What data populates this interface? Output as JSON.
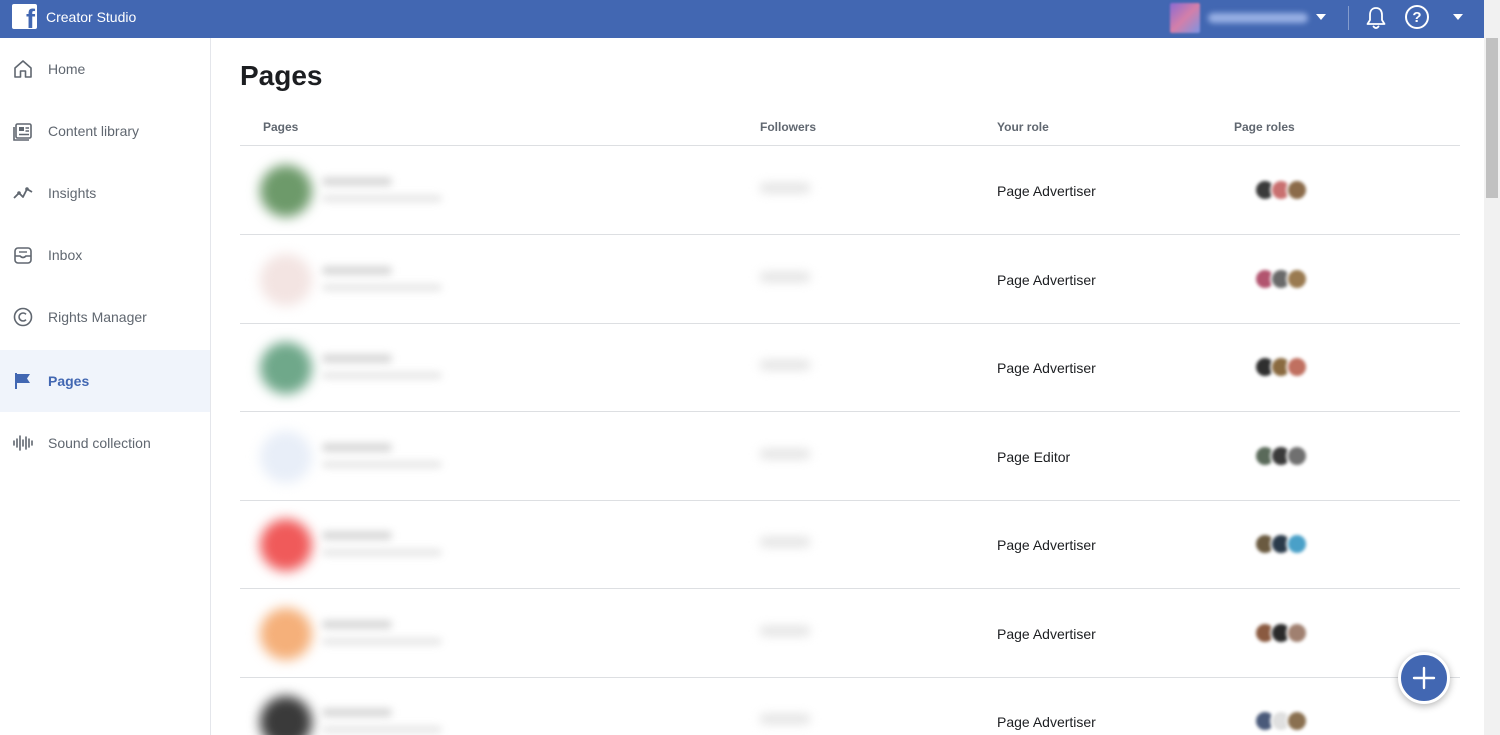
{
  "topbar": {
    "app_title": "Creator Studio",
    "brand_color": "#4267b2"
  },
  "sidebar": {
    "items": [
      {
        "label": "Home",
        "icon": "home-icon",
        "active": false
      },
      {
        "label": "Content library",
        "icon": "content-library-icon",
        "active": false
      },
      {
        "label": "Insights",
        "icon": "insights-icon",
        "active": false
      },
      {
        "label": "Inbox",
        "icon": "inbox-icon",
        "active": false
      },
      {
        "label": "Rights Manager",
        "icon": "copyright-icon",
        "active": false
      },
      {
        "label": "Pages",
        "icon": "flag-icon",
        "active": true
      },
      {
        "label": "Sound collection",
        "icon": "sound-wave-icon",
        "active": false
      }
    ]
  },
  "main": {
    "title": "Pages",
    "columns": [
      "Pages",
      "Followers",
      "Your role",
      "Page roles"
    ],
    "rows": [
      {
        "role": "Page Advertiser",
        "avatar_color": "#6d9a6a",
        "roles_colors": [
          "#3a3a3a",
          "#c97070",
          "#8b6b4a"
        ]
      },
      {
        "role": "Page Advertiser",
        "avatar_color": "#f3e4e2",
        "roles_colors": [
          "#b2546f",
          "#6a6a6a",
          "#9a7a50"
        ]
      },
      {
        "role": "Page Advertiser",
        "avatar_color": "#6fa88a",
        "roles_colors": [
          "#2f2f2f",
          "#8a6a40",
          "#c07060"
        ]
      },
      {
        "role": "Page Editor",
        "avatar_color": "#e8eef8",
        "roles_colors": [
          "#5a6a5a",
          "#3a3a3a",
          "#707070"
        ]
      },
      {
        "role": "Page Advertiser",
        "avatar_color": "#f05a5a",
        "roles_colors": [
          "#6a5a40",
          "#2a3a4a",
          "#4aa0c8"
        ]
      },
      {
        "role": "Page Advertiser",
        "avatar_color": "#f5b07a",
        "roles_colors": [
          "#8a5a40",
          "#2a2a2a",
          "#a08070"
        ]
      },
      {
        "role": "Page Advertiser",
        "avatar_color": "#3a3a3a",
        "roles_colors": [
          "#4a5a7a",
          "#e0e0e0",
          "#8a7050"
        ]
      }
    ]
  }
}
